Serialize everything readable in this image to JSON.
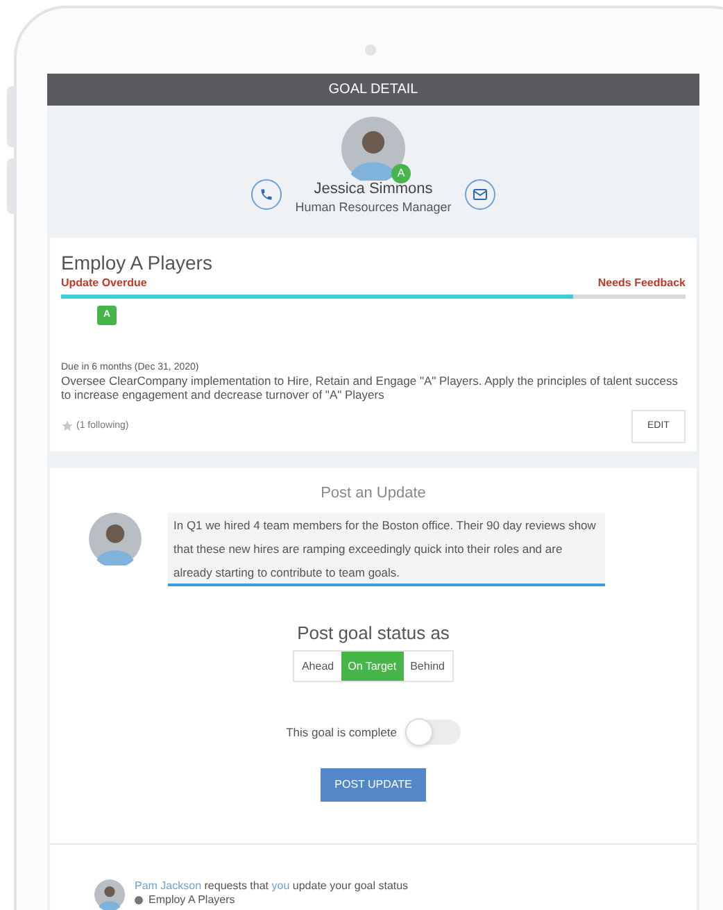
{
  "header": {
    "title": "GOAL DETAIL"
  },
  "profile": {
    "badge": "A",
    "name": "Jessica Simmons",
    "role": "Human Resources Manager"
  },
  "goal": {
    "title": "Employ A Players",
    "update_status": "Update Overdue",
    "feedback_status": "Needs Feedback",
    "progress": {
      "level": 0.82
    },
    "grade": "A",
    "due": "Due in 6 months (Dec 31, 2020)",
    "description": "Oversee ClearCompany implementation to Hire, Retain and Engage \"A\" Players. Apply the principles of talent success to increase engagement and decrease turnover of \"A\" Players",
    "following": "(1 following)",
    "edit_button": "EDIT"
  },
  "post_update": {
    "title": "Post an Update",
    "value": "In Q1 we hired 4 team members for the Boston office. Their 90 day reviews show that these new hires are ramping exceedingly quick into their roles and are already starting to contribute to team goals.",
    "status_label": "Post goal status as",
    "status_options": [
      {
        "label": "Ahead",
        "selected": false
      },
      {
        "label": "On Target",
        "selected": true
      },
      {
        "label": "Behind",
        "selected": false
      }
    ],
    "complete_label": "This goal is complete",
    "complete": {
      "on": false
    },
    "submit": "POST UPDATE"
  },
  "notification": {
    "requester": "Pam Jackson",
    "text_1": "requests that",
    "target": "you",
    "text_2": "update your goal status",
    "goal": "Employ A Players"
  }
}
